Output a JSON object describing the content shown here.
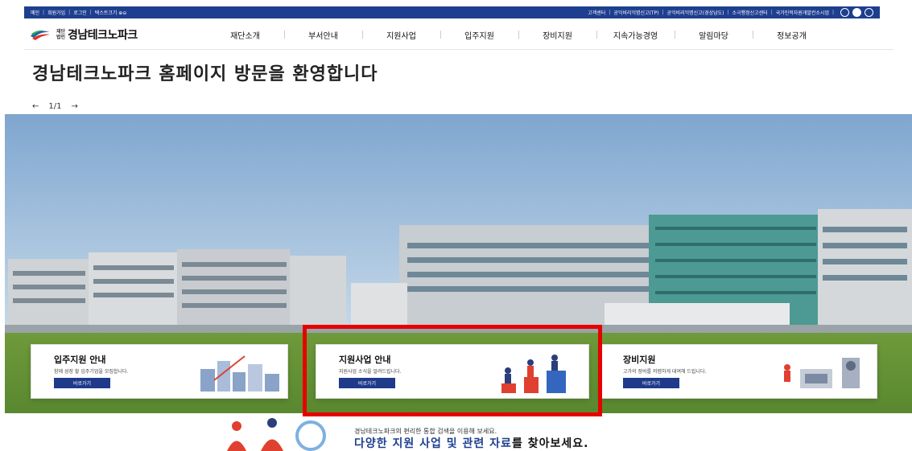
{
  "topbar": {
    "left": [
      "메인",
      "회원가입",
      "로그인",
      "텍스트크기 ⊕⊖"
    ],
    "right": [
      "고객센터",
      "공익비리익명신고(TP)",
      "공익비리익명신고(경상남도)",
      "소극행정신고센터",
      "국가인적자원개발컨소시엄"
    ],
    "sns_icons": [
      "blog-icon",
      "facebook-icon",
      "youtube-icon"
    ]
  },
  "logo": {
    "small": "재단\n법인",
    "text": "경남테크노파크"
  },
  "menu": [
    "재단소개",
    "부서안내",
    "지원사업",
    "입주지원",
    "장비지원",
    "지속가능경영",
    "알림마당",
    "정보공개"
  ],
  "welcome": "경남테크노파크 홈페이지 방문을 환영합니다",
  "pager": {
    "prev": "←",
    "page": "1/1",
    "next": "→"
  },
  "cards": [
    {
      "title": "입주지원 안내",
      "desc": "함께 성장 할 입주기업을 모집합니다.",
      "button": "바로가기"
    },
    {
      "title": "지원사업 안내",
      "desc": "지원사업 소식을 알려드립니다.",
      "button": "바로가기"
    },
    {
      "title": "장비지원",
      "desc": "고가의 장비를 저렴하게 대여해 드립니다.",
      "button": "바로가기"
    }
  ],
  "search": {
    "line1": "경남테크노파크의 편리한 통합 검색을 이용해 보세요.",
    "line2_highlight": "다양한 지원 사업 및 관련 자료",
    "line2_rest": "를 찾아보세요."
  },
  "colors": {
    "brand": "#1e3f8f",
    "highlight": "#e60000"
  }
}
